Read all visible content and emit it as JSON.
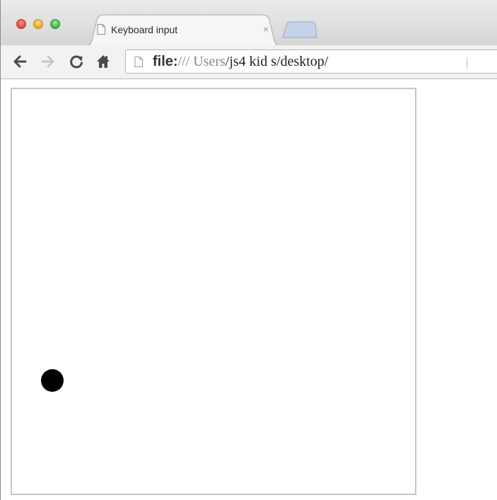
{
  "window": {
    "tab": {
      "title": "Keyboard input",
      "close_glyph": "×"
    },
    "toolbar": {
      "back_icon": "back-arrow-icon",
      "forward_icon": "forward-arrow-icon",
      "reload_icon": "reload-icon",
      "home_icon": "home-icon",
      "address": {
        "scheme": "file:",
        "separator": "///",
        "path_prefix": " Users",
        "path_rest": "/js4  kid  s/desktop/"
      }
    }
  },
  "page": {
    "canvas": {
      "background": "#ffffff",
      "border_color": "#c6c6c6",
      "ball_color": "#000000"
    }
  }
}
